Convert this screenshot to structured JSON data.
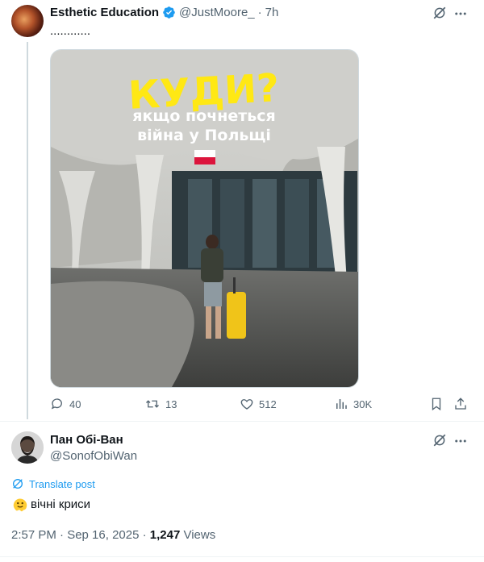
{
  "tweet": {
    "author_name": "Esthetic Education",
    "handle": "@JustMoore_",
    "separator": "·",
    "time": "7h",
    "text": "............",
    "media": {
      "title": "КУДИ?",
      "line1": "якщо почнеться",
      "line2": "війна у Польщі",
      "flag_colors": [
        "#ffffff",
        "#dc143c"
      ]
    },
    "stats": {
      "replies": "40",
      "reposts": "13",
      "likes": "512",
      "views": "30K"
    }
  },
  "reply": {
    "author_name": "Пан Обі-Ван",
    "handle": "@SonofObiWan",
    "translate_label": "Translate post",
    "text": "вічні криси",
    "timestamp": "2:57 PM · Sep 16, 2025 · ",
    "views_count": "1,247",
    "views_label": " Views"
  },
  "colors": {
    "accent": "#1d9bf0",
    "title_yellow": "#ffe814"
  }
}
